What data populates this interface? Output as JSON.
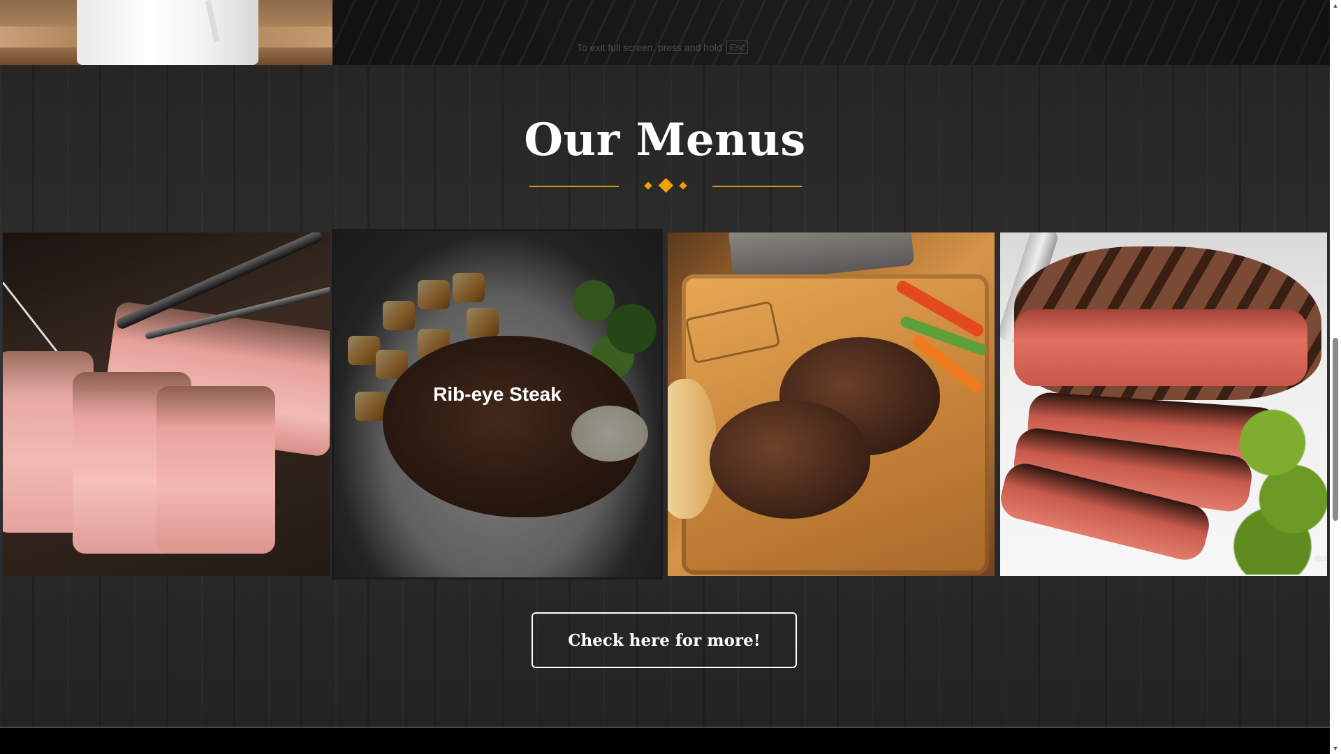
{
  "top_strip": {
    "fullscreen_hint": "To exit full screen, press and hold",
    "fullscreen_key": "Esc"
  },
  "menu_section": {
    "title": "Our Menus",
    "accent_color": "#f0a300",
    "cards": [
      {
        "label": ""
      },
      {
        "label": "Rib-eye Steak"
      },
      {
        "label": ""
      },
      {
        "label": "",
        "watermark": "dol"
      }
    ],
    "more_button": "Check here for more!"
  },
  "icons": {
    "divider": "diamond-ornament-icon",
    "scroll_up": "chevron-up-icon",
    "scroll_down": "chevron-down-icon"
  }
}
